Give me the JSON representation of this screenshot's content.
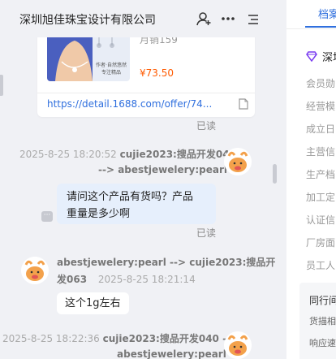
{
  "header": {
    "title": "深圳旭佳珠宝设计有限公司",
    "icons": [
      "add-user-icon",
      "more-icon",
      "menu-icon"
    ]
  },
  "product_card": {
    "image_caption_line1": "作者·自然悠然",
    "image_caption_line2": "专注精品",
    "sales": "月销159",
    "price": "¥73.50",
    "link": "https://detail.1688.com/offer/74...",
    "read_status": "已读"
  },
  "messages": [
    {
      "meta": "2025-8-25 18:20:52",
      "sender": "cujie2023:搜品开发040",
      "route": "--> abestjewelery:pearl",
      "text_line1": "请问这个产品有货吗？产品",
      "text_line2": "重量是多少啊",
      "read_status": "已读"
    },
    {
      "sender": "abestjewelery:pearl --> cujie2023:搜品开",
      "sender_line2": "发063",
      "meta": "2025-8-25 18:21:14",
      "text": "这个1g左右"
    },
    {
      "meta": "2025-8-25 18:22:36",
      "sender": "cujie2023:搜品开发040 -->",
      "route": "abestjewelery:pearl"
    }
  ],
  "side_panel": {
    "tab": "档案",
    "company": "深圳",
    "labels": [
      "会员勋",
      "经营模",
      "成立日",
      "主营信",
      "生产档",
      "加工定",
      "认证信",
      "厂房面",
      "员工人"
    ],
    "sub_title": "同行间",
    "sub_items": [
      "货描相",
      "响应速"
    ]
  },
  "colors": {
    "accent": "#2f6fde",
    "price": "#ff5a00",
    "bubble_self": "#e6effc"
  }
}
